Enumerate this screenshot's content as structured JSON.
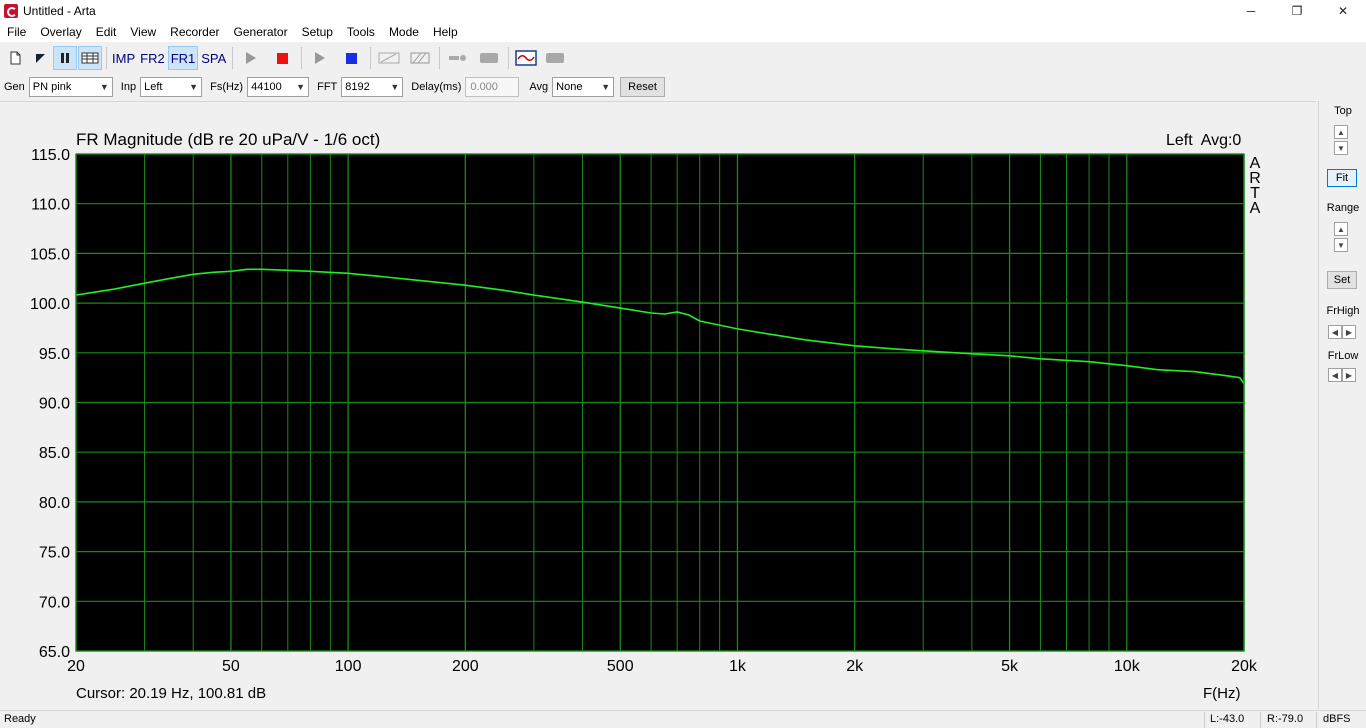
{
  "window": {
    "title": "Untitled - Arta",
    "minimize": "─",
    "maximize": "❐",
    "close": "✕"
  },
  "menu": [
    "File",
    "Overlay",
    "Edit",
    "View",
    "Recorder",
    "Generator",
    "Setup",
    "Tools",
    "Mode",
    "Help"
  ],
  "toolbar": {
    "imp": "IMP",
    "fr2": "FR2",
    "fr1": "FR1",
    "spa": "SPA",
    "active_mode": "FR1"
  },
  "params": {
    "gen_label": "Gen",
    "gen_value": "PN pink",
    "inp_label": "Inp",
    "inp_value": "Left",
    "fs_label": "Fs(Hz)",
    "fs_value": "44100",
    "fft_label": "FFT",
    "fft_value": "8192",
    "delay_label": "Delay(ms)",
    "delay_value": "0.000",
    "avg_label": "Avg",
    "avg_value": "None",
    "reset_label": "Reset"
  },
  "plot": {
    "channel_info": "Left  Avg:0",
    "watermark": "ARTA",
    "cursor_readout": "Cursor: 20.19 Hz, 100.81 dB",
    "x_axis_label": "F(Hz)"
  },
  "chart_data": {
    "type": "line",
    "title": "FR Magnitude (dB re 20 uPa/V - 1/6 oct)",
    "x_scale": "log",
    "xlim": [
      20,
      20000
    ],
    "ylim": [
      65,
      115
    ],
    "grid": true,
    "background": "#000000",
    "grid_color": "#1a8a1a",
    "line_color": "#22ee22",
    "y_ticks": [
      "115.0",
      "110.0",
      "105.0",
      "100.0",
      "95.0",
      "90.0",
      "85.0",
      "80.0",
      "75.0",
      "70.0",
      "65.0"
    ],
    "y_tick_values": [
      115,
      110,
      105,
      100,
      95,
      90,
      85,
      80,
      75,
      70,
      65
    ],
    "x_ticks": [
      "20",
      "50",
      "100",
      "200",
      "500",
      "1k",
      "2k",
      "5k",
      "10k",
      "20k"
    ],
    "x_tick_values": [
      20,
      50,
      100,
      200,
      500,
      1000,
      2000,
      5000,
      10000,
      20000
    ],
    "series": [
      {
        "x": [
          20,
          25,
          30,
          35,
          40,
          45,
          50,
          55,
          60,
          70,
          80,
          100,
          120,
          150,
          200,
          250,
          300,
          400,
          500,
          600,
          650,
          700,
          750,
          800,
          1000,
          1200,
          1500,
          2000,
          2500,
          3000,
          4000,
          5000,
          6000,
          8000,
          10000,
          12000,
          15000,
          18000,
          19500,
          20000
        ],
        "y": [
          100.8,
          101.4,
          102.0,
          102.5,
          102.9,
          103.1,
          103.2,
          103.4,
          103.4,
          103.3,
          103.2,
          103.0,
          102.7,
          102.3,
          101.8,
          101.3,
          100.8,
          100.1,
          99.5,
          99.0,
          98.9,
          99.1,
          98.8,
          98.2,
          97.4,
          96.9,
          96.3,
          95.7,
          95.4,
          95.2,
          94.9,
          94.7,
          94.4,
          94.1,
          93.7,
          93.3,
          93.1,
          92.7,
          92.5,
          91.9
        ]
      }
    ]
  },
  "side": {
    "top_label": "Top",
    "fit_label": "Fit",
    "range_label": "Range",
    "set_label": "Set",
    "frhigh_label": "FrHigh",
    "frlow_label": "FrLow"
  },
  "status": {
    "ready": "Ready",
    "left_level": "L:-43.0",
    "right_level": "R:-79.0",
    "unit": "dBFS"
  }
}
